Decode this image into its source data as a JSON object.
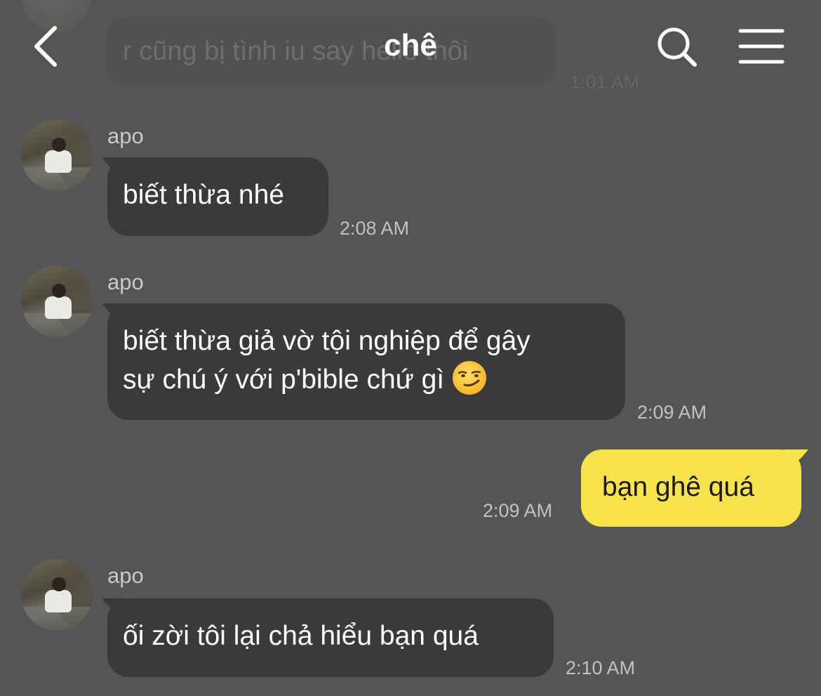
{
  "header": {
    "title": "chê"
  },
  "background_message": {
    "text": "r cũng bị tình iu say hello thôi",
    "time": "1:01 AM"
  },
  "messages": [
    {
      "sender": "apo",
      "text": "biết thừa nhé",
      "time": "2:08 AM"
    },
    {
      "sender": "apo",
      "lines": [
        "biết thừa giả vờ tội nghiệp để gây",
        "sự chú ý với p'bible chứ gì"
      ],
      "emoji": "smirk",
      "time": "2:09 AM"
    },
    {
      "sender": "me",
      "text": "bạn ghê quá",
      "time": "2:09 AM"
    },
    {
      "sender": "apo",
      "text": "ối zời tôi lại chả hiểu bạn quá",
      "time": "2:10 AM"
    }
  ],
  "icons": {
    "back": "chevron-left-icon",
    "search": "search-icon",
    "menu": "hamburger-menu-icon"
  },
  "colors": {
    "background": "#555456",
    "incoming_bubble": "#3a393b",
    "outgoing_bubble": "#f9e34a"
  }
}
